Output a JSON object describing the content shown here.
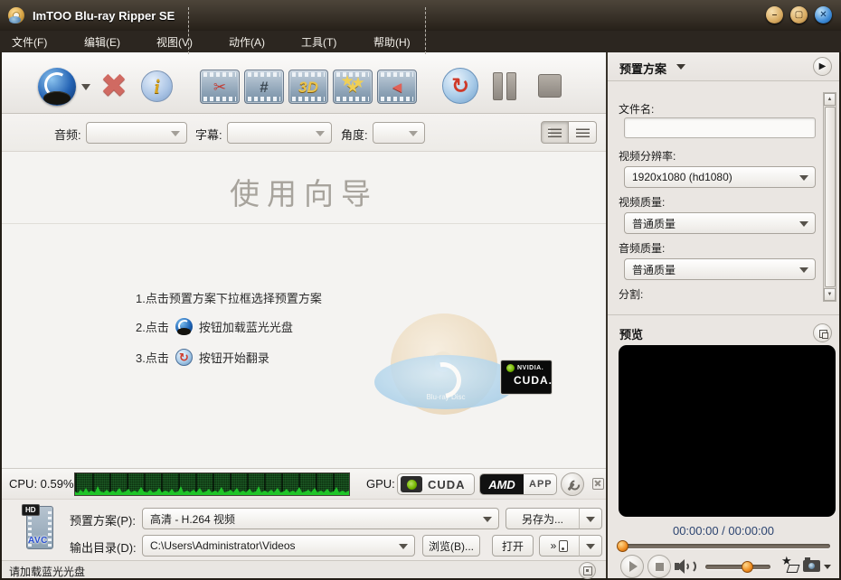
{
  "window": {
    "title": "ImTOO Blu-ray Ripper SE"
  },
  "icons": {
    "minimize": "–",
    "maximize": "▢",
    "close": "✕",
    "remove": "✖",
    "info": "i",
    "clip": "✂",
    "chapter": "#",
    "three_d": "3D",
    "effects": "★",
    "crop": "◄",
    "rip": "↻",
    "caret_down": "",
    "panel_expand": "▶",
    "scroll_up": "▲",
    "scroll_down": "▼",
    "more": "»"
  },
  "menu": {
    "items": [
      {
        "label": "文件(F)"
      },
      {
        "label": "编辑(E)"
      },
      {
        "label": "视图(V)"
      },
      {
        "label": "动作(A)"
      },
      {
        "label": "工具(T)"
      },
      {
        "label": "帮助(H)"
      }
    ]
  },
  "media_bar": {
    "audio_label": "音频:",
    "subtitle_label": "字幕:",
    "angle_label": "角度:"
  },
  "guide": {
    "title": "使用向导",
    "step1": "1.点击预置方案下拉框选择预置方案",
    "step2_pre": "2.点击",
    "step2_post": "按钮加载蓝光光盘",
    "step3_pre": "3.点击",
    "step3_post": "按钮开始翻录"
  },
  "watermark": {
    "nvidia": "NVIDIA.",
    "cuda": "CUDA.",
    "disc": "Blu-ray Disc"
  },
  "perf": {
    "cpu": "CPU: 0.59%",
    "gpu": "GPU:",
    "cuda": "CUDA",
    "amd": "AMD",
    "app": "APP"
  },
  "output": {
    "preset_label": "预置方案(P):",
    "preset_value": "高清 - H.264 视频",
    "save_as": "另存为...",
    "dir_label": "输出目录(D):",
    "dir_value": "C:\\Users\\Administrator\\Videos",
    "browse": "浏览(B)...",
    "open": "打开",
    "hd": "HD",
    "avc": "AVC"
  },
  "statusbar": {
    "message": "请加载蓝光光盘"
  },
  "preset_panel": {
    "header": "预置方案",
    "filename_label": "文件名:",
    "resolution_label": "视频分辨率:",
    "resolution_value": "1920x1080 (hd1080)",
    "video_quality_label": "视频质量:",
    "video_quality_value": "普通质量",
    "audio_quality_label": "音频质量:",
    "audio_quality_value": "普通质量",
    "split_label": "分割:"
  },
  "preview": {
    "header": "预览",
    "time": "00:00:00 / 00:00:00"
  }
}
